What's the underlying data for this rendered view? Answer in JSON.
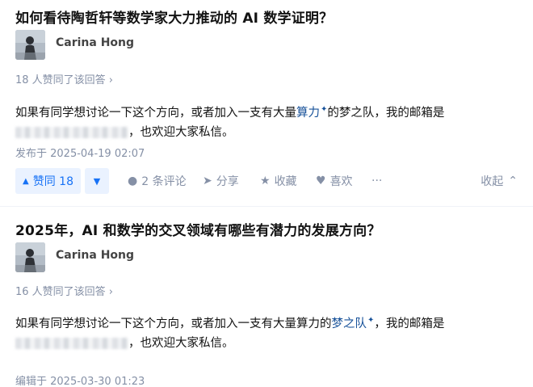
{
  "answers": [
    {
      "question": "如何看待陶哲轩等数学家大力推动的 AI 数学证明？",
      "author": "Carina Hong",
      "votes_text": "18 人赞同了该回答",
      "content_line1_a": "如果有同学想讨论一下这个方向，或者加入一支有大量",
      "content_line1_kw": "算力",
      "content_line1_b": "的梦之队，我的邮箱是",
      "content_line2": "，也欢迎大家私信。",
      "meta": "发布于 2025-04-19 02:07",
      "actions": {
        "upvote": "赞同 18",
        "comments": "2 条评论",
        "share": "分享",
        "collect": "收藏",
        "like": "喜欢",
        "more": "···",
        "collapse": "收起"
      }
    },
    {
      "question": "2025年，AI 和数学的交叉领域有哪些有潜力的发展方向？",
      "author": "Carina Hong",
      "votes_text": "16 人赞同了该回答",
      "content_line1_a": "如果有同学想讨论一下这个方向，或者加入一支有大量算力的",
      "content_line1_kw": "梦之队",
      "content_line1_b": "，我的邮箱是",
      "content_line2": "，也欢迎大家私信。",
      "meta": "编辑于 2025-03-30 01:23"
    }
  ],
  "icons": {
    "spark": "✦",
    "chevron_right": "›",
    "upvote": "▲",
    "downvote": "▼",
    "comment": "●",
    "share": "➤",
    "collect": "★",
    "like": "♥",
    "collapse_chevron": "⌃"
  },
  "colors": {
    "accent": "#1772f6",
    "keyword": "#175199",
    "muted": "#8590a6",
    "vote_bg": "#eaf2ff"
  }
}
